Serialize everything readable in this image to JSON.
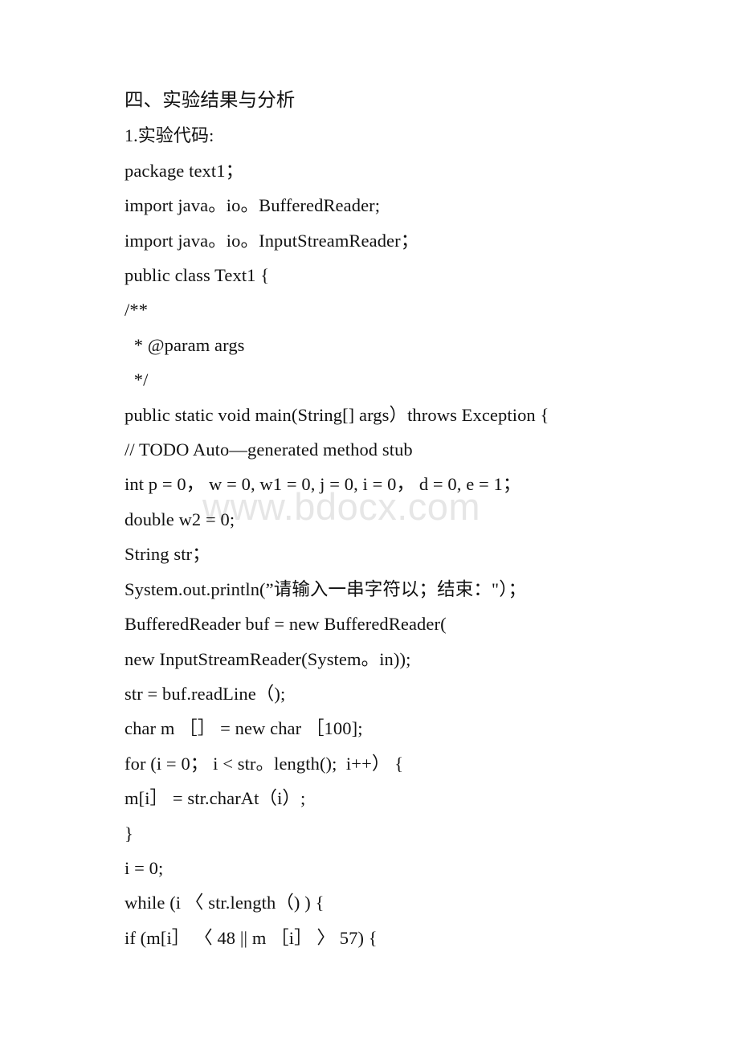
{
  "document": {
    "heading": "四、实验结果与分析",
    "subheading": "1.实验代码:",
    "watermark": "www.bdocx.com",
    "watermark_color": "#e6e6e6",
    "text_color": "#111111",
    "background_color": "#ffffff",
    "code_lines": [
      {
        "text": "package text1；",
        "indent": 0
      },
      {
        "text": "import java。io。BufferedReader;",
        "indent": 0
      },
      {
        "text": "import java。io。InputStreamReader；",
        "indent": 0
      },
      {
        "text": "public class Text1 {",
        "indent": 0
      },
      {
        "text": "/**",
        "indent": 0
      },
      {
        "text": " * @param args",
        "indent": 1
      },
      {
        "text": " */",
        "indent": 1
      },
      {
        "text": "public static void main(String[] args）throws Exception {",
        "indent": 0
      },
      {
        "text": "// TODO Auto—generated method stub",
        "indent": 0
      },
      {
        "text": "int p = 0， w = 0, w1 = 0, j = 0, i = 0， d = 0, e = 1；",
        "indent": 0
      },
      {
        "text": "double w2 = 0;",
        "indent": 0
      },
      {
        "text": "String str；",
        "indent": 0
      },
      {
        "text": "System.out.println(”请输入一串字符以；结束：\"）；",
        "indent": 0
      },
      {
        "text": "BufferedReader buf = new BufferedReader(",
        "indent": 0
      },
      {
        "text": "new InputStreamReader(System。in));",
        "indent": 0
      },
      {
        "text": "str = buf.readLine（);",
        "indent": 0
      },
      {
        "text": "char m ［］ = new char ［100];",
        "indent": 0
      },
      {
        "text": "for (i = 0； i < str。length();  i++） {",
        "indent": 0
      },
      {
        "text": "m[i］ = str.charAt（i）;",
        "indent": 0
      },
      {
        "text": "}",
        "indent": 0
      },
      {
        "text": "i = 0;",
        "indent": 0
      },
      {
        "text": "while (i 〈 str.length（) ) {",
        "indent": 0
      },
      {
        "text": "if (m[i］ 〈 48 || m ［i］ 〉 57) {",
        "indent": 0
      }
    ]
  }
}
